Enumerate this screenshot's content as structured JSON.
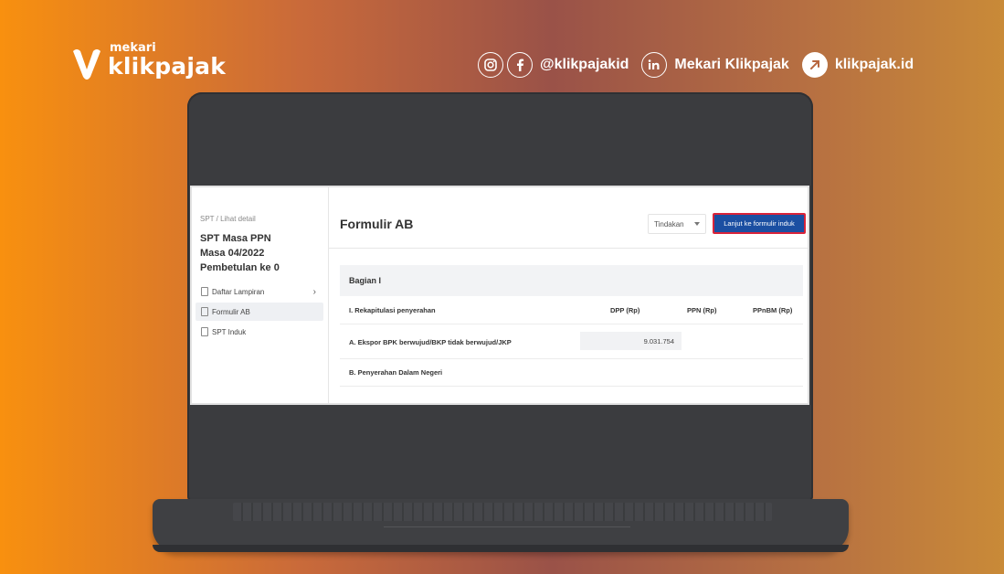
{
  "brand": {
    "small": "mekari",
    "big": "klikpajak"
  },
  "socials": {
    "handle": "@klikpajakid",
    "linkedin": "Mekari Klikpajak",
    "website": "klikpajak.id"
  },
  "screen": {
    "breadcrumb": "SPT / Lihat detail",
    "spt_line1": "SPT Masa PPN",
    "spt_line2": "Masa 04/2022",
    "spt_line3": "Pembetulan ke 0",
    "nav": [
      {
        "label": "Daftar Lampiran"
      },
      {
        "label": "Formulir AB"
      },
      {
        "label": "SPT Induk"
      }
    ],
    "form_title": "Formulir AB",
    "actions_select": "Tindakan",
    "primary_button": "Lanjut ke formulir induk",
    "section_title": "Bagian I",
    "table": {
      "row1_label": "I. Rekapitulasi penyerahan",
      "col_dpp": "DPP (Rp)",
      "col_ppn": "PPN (Rp)",
      "col_ppnbm": "PPnBM (Rp)",
      "row2_label": "A. Ekspor BPK berwujud/BKP tidak berwujud/JKP",
      "row2_dpp": "9.031.754",
      "row3_label": "B. Penyerahan Dalam Negeri"
    }
  },
  "colors": {
    "primary_button": "#1b4fa2",
    "highlight_border": "#d9243a"
  }
}
